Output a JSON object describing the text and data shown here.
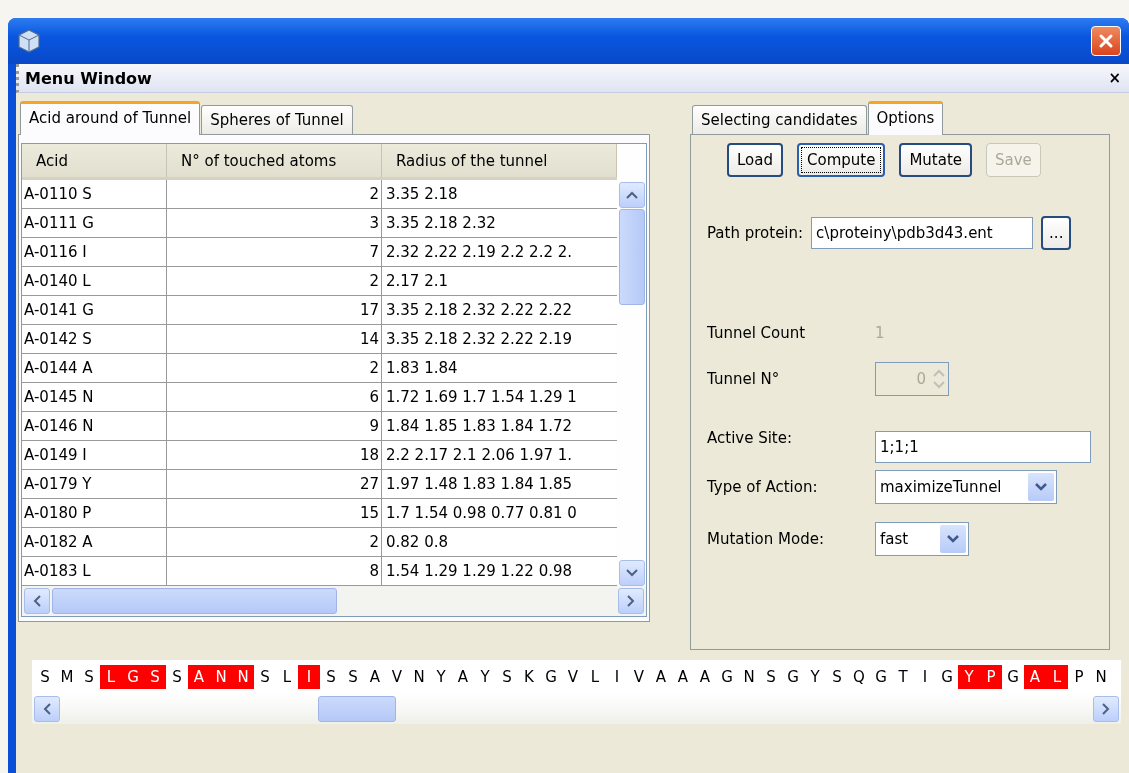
{
  "menu_window": {
    "title": "Menu Window",
    "close": "×"
  },
  "left_tabs": [
    {
      "label": "Acid around of Tunnel",
      "selected": true
    },
    {
      "label": "Spheres of Tunnel",
      "selected": false
    }
  ],
  "table": {
    "columns": [
      "Acid",
      "N° of touched atoms",
      "Radius of the tunnel"
    ],
    "rows": [
      [
        "A-0110 S",
        "2",
        "3.35 2.18"
      ],
      [
        "A-0111 G",
        "3",
        "3.35 2.18 2.32"
      ],
      [
        "A-0116 I",
        "7",
        "2.32 2.22 2.19 2.2 2.2 2."
      ],
      [
        "A-0140 L",
        "2",
        "2.17 2.1"
      ],
      [
        "A-0141 G",
        "17",
        "3.35 2.18 2.32 2.22 2.22"
      ],
      [
        "A-0142 S",
        "14",
        "3.35 2.18 2.32 2.22 2.19"
      ],
      [
        "A-0144 A",
        "2",
        "1.83 1.84"
      ],
      [
        "A-0145 N",
        "6",
        "1.72 1.69 1.7 1.54 1.29 1"
      ],
      [
        "A-0146 N",
        "9",
        "1.84 1.85 1.83 1.84 1.72"
      ],
      [
        "A-0149 I",
        "18",
        "2.2 2.17 2.1 2.06 1.97 1."
      ],
      [
        "A-0179 Y",
        "27",
        "1.97 1.48 1.83 1.84 1.85"
      ],
      [
        "A-0180 P",
        "15",
        "1.7 1.54 0.98 0.77 0.81 0"
      ],
      [
        "A-0182 A",
        "2",
        "0.82 0.8"
      ],
      [
        "A-0183 L",
        "8",
        "1.54 1.29 1.29 1.22 0.98"
      ]
    ]
  },
  "right_tabs": [
    {
      "label": "Selecting candidates",
      "selected": false
    },
    {
      "label": "Options",
      "selected": true
    }
  ],
  "buttons": [
    {
      "label": "Load",
      "disabled": false,
      "focused": false
    },
    {
      "label": "Compute",
      "disabled": false,
      "focused": true
    },
    {
      "label": "Mutate",
      "disabled": false,
      "focused": false
    },
    {
      "label": "Save",
      "disabled": true,
      "focused": false
    }
  ],
  "path_protein": {
    "label": "Path protein:",
    "value": "c\\proteiny\\pdb3d43.ent",
    "browse": "..."
  },
  "tunnel_count": {
    "label": "Tunnel Count",
    "value": "1"
  },
  "tunnel_no": {
    "label": "Tunnel N°",
    "value": "0",
    "disabled": true
  },
  "active_site": {
    "label": "Active Site:",
    "value": "1;1;1"
  },
  "type_of_action": {
    "label": "Type of Action:",
    "value": "maximizeTunnel"
  },
  "mutation_mode": {
    "label": "Mutation Mode:",
    "value": "fast"
  },
  "sequence": [
    {
      "residue": "S",
      "highlighted": false
    },
    {
      "residue": "M",
      "highlighted": false
    },
    {
      "residue": "S",
      "highlighted": false
    },
    {
      "residue": "L",
      "highlighted": true
    },
    {
      "residue": "G",
      "highlighted": true
    },
    {
      "residue": "S",
      "highlighted": true
    },
    {
      "residue": "S",
      "highlighted": false
    },
    {
      "residue": "A",
      "highlighted": true
    },
    {
      "residue": "N",
      "highlighted": true
    },
    {
      "residue": "N",
      "highlighted": true
    },
    {
      "residue": "S",
      "highlighted": false
    },
    {
      "residue": "L",
      "highlighted": false
    },
    {
      "residue": "I",
      "highlighted": true
    },
    {
      "residue": "S",
      "highlighted": false
    },
    {
      "residue": "S",
      "highlighted": false
    },
    {
      "residue": "A",
      "highlighted": false
    },
    {
      "residue": "V",
      "highlighted": false
    },
    {
      "residue": "N",
      "highlighted": false
    },
    {
      "residue": "Y",
      "highlighted": false
    },
    {
      "residue": "A",
      "highlighted": false
    },
    {
      "residue": "Y",
      "highlighted": false
    },
    {
      "residue": "S",
      "highlighted": false
    },
    {
      "residue": "K",
      "highlighted": false
    },
    {
      "residue": "G",
      "highlighted": false
    },
    {
      "residue": "V",
      "highlighted": false
    },
    {
      "residue": "L",
      "highlighted": false
    },
    {
      "residue": "I",
      "highlighted": false
    },
    {
      "residue": "V",
      "highlighted": false
    },
    {
      "residue": "A",
      "highlighted": false
    },
    {
      "residue": "A",
      "highlighted": false
    },
    {
      "residue": "A",
      "highlighted": false
    },
    {
      "residue": "G",
      "highlighted": false
    },
    {
      "residue": "N",
      "highlighted": false
    },
    {
      "residue": "S",
      "highlighted": false
    },
    {
      "residue": "G",
      "highlighted": false
    },
    {
      "residue": "Y",
      "highlighted": false
    },
    {
      "residue": "S",
      "highlighted": false
    },
    {
      "residue": "Q",
      "highlighted": false
    },
    {
      "residue": "G",
      "highlighted": false
    },
    {
      "residue": "T",
      "highlighted": false
    },
    {
      "residue": "I",
      "highlighted": false
    },
    {
      "residue": "G",
      "highlighted": false
    },
    {
      "residue": "Y",
      "highlighted": true
    },
    {
      "residue": "P",
      "highlighted": true
    },
    {
      "residue": "G",
      "highlighted": false
    },
    {
      "residue": "A",
      "highlighted": true
    },
    {
      "residue": "L",
      "highlighted": true
    },
    {
      "residue": "P",
      "highlighted": false
    },
    {
      "residue": "N",
      "highlighted": false
    }
  ]
}
